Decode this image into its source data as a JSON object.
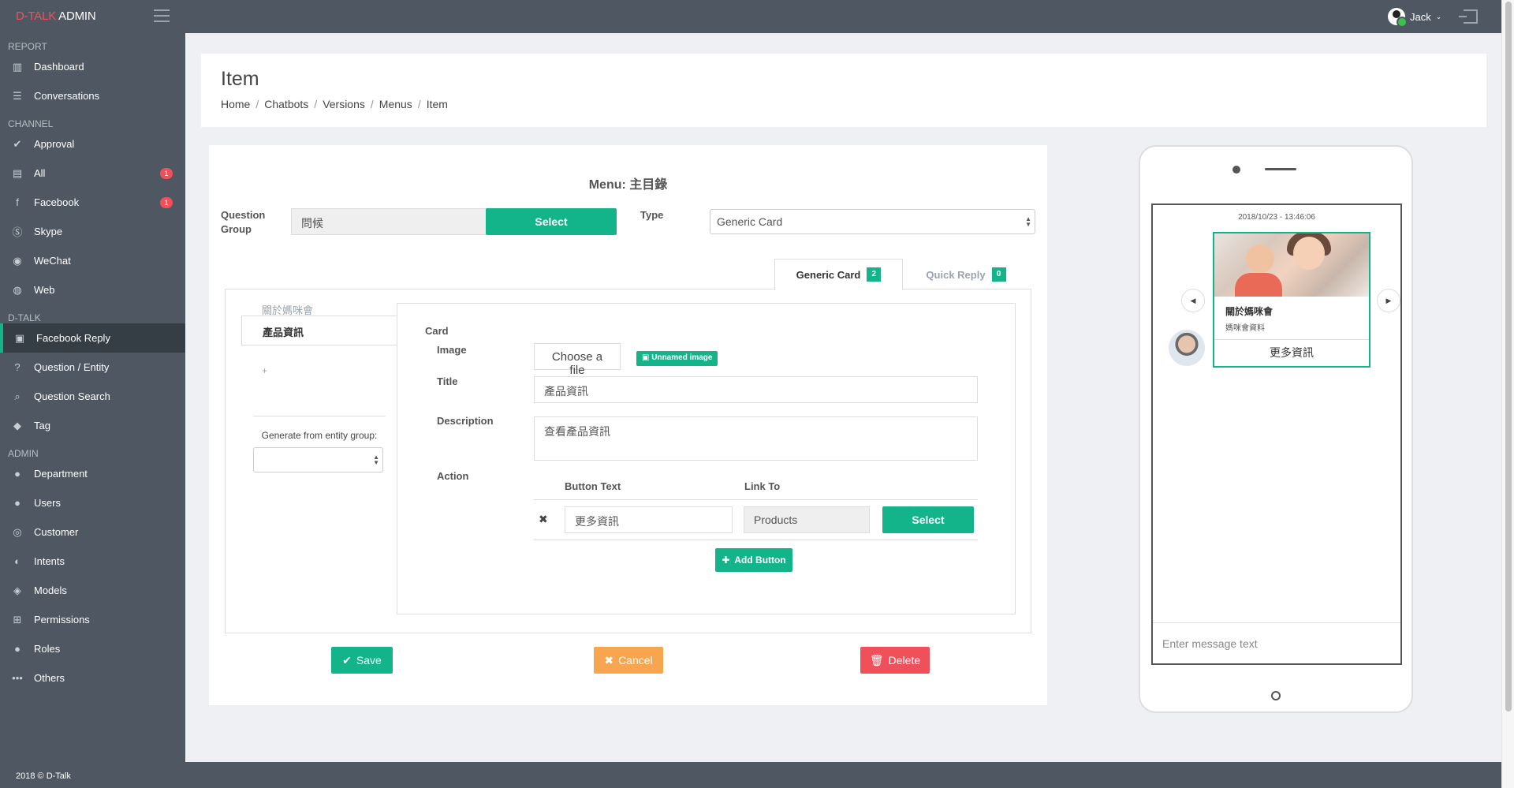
{
  "topbar": {
    "logo_red": "D-TALK",
    "logo_white": " ADMIN",
    "user": "Jack"
  },
  "sidebar": {
    "sections": [
      {
        "title": "REPORT",
        "items": [
          {
            "label": "Dashboard",
            "icon": "bar-chart-icon"
          },
          {
            "label": "Conversations",
            "icon": "list-icon"
          }
        ]
      },
      {
        "title": "CHANNEL",
        "items": [
          {
            "label": "Approval",
            "icon": "check-icon"
          },
          {
            "label": "All",
            "icon": "inbox-icon",
            "badge": "1"
          },
          {
            "label": "Facebook",
            "icon": "facebook-icon",
            "badge": "1"
          },
          {
            "label": "Skype",
            "icon": "skype-icon"
          },
          {
            "label": "WeChat",
            "icon": "wechat-icon"
          },
          {
            "label": "Web",
            "icon": "globe-icon"
          }
        ]
      },
      {
        "title": "D-TALK",
        "items": [
          {
            "label": "Facebook Reply",
            "icon": "facebook-square-icon",
            "active": true
          },
          {
            "label": "Question / Entity",
            "icon": "question-icon"
          },
          {
            "label": "Question Search",
            "icon": "search-icon"
          },
          {
            "label": "Tag",
            "icon": "tag-icon"
          }
        ]
      },
      {
        "title": "ADMIN",
        "items": [
          {
            "label": "Department",
            "icon": "group-icon"
          },
          {
            "label": "Users",
            "icon": "user-icon"
          },
          {
            "label": "Customer",
            "icon": "customer-icon"
          },
          {
            "label": "Intents",
            "icon": "question-circle-icon"
          },
          {
            "label": "Models",
            "icon": "cube-icon"
          },
          {
            "label": "Permissions",
            "icon": "sitemap-icon"
          },
          {
            "label": "Roles",
            "icon": "users-icon"
          },
          {
            "label": "Others",
            "icon": "ellipsis-icon"
          }
        ]
      }
    ]
  },
  "header": {
    "title": "Item",
    "breadcrumb": [
      "Home",
      "Chatbots",
      "Versions",
      "Menus",
      "Item"
    ]
  },
  "form": {
    "menu_title": "Menu: 主目錄",
    "question_group_label": "Question Group",
    "question_group_value": "問候",
    "select_label": "Select",
    "type_label": "Type",
    "type_value": "Generic Card",
    "tabs": [
      {
        "label": "Generic Card",
        "count": "2"
      },
      {
        "label": "Quick Reply",
        "count": "0"
      }
    ],
    "card_list": [
      "關於媽咪會",
      "產品資訊"
    ],
    "add_symbol": "+",
    "generate_label": "Generate from entity group:",
    "card_heading": "Card",
    "image_label": "Image",
    "choose_file": "Choose a file",
    "image_tag": "Unnamed image",
    "title_label": "Title",
    "title_value": "產品資訊",
    "description_label": "Description",
    "description_value": "查看產品資訊",
    "action_label": "Action",
    "button_text_header": "Button Text",
    "link_to_header": "Link To",
    "button_text_value": "更多資訊",
    "link_value": "Products",
    "add_button": "Add Button"
  },
  "actions": {
    "save": "Save",
    "cancel": "Cancel",
    "delete": "Delete"
  },
  "preview": {
    "timestamp": "2018/10/23 - 13:46:06",
    "card_title": "關於媽咪會",
    "card_subtitle": "媽咪會資料",
    "card_button": "更多資訊",
    "input_placeholder": "Enter message text"
  },
  "footer": {
    "text": "2018 © D-Talk"
  },
  "colors": {
    "accent": "#13b48a",
    "sidebar": "#4f5862",
    "cancel": "#f8a550",
    "delete": "#f0505a"
  }
}
